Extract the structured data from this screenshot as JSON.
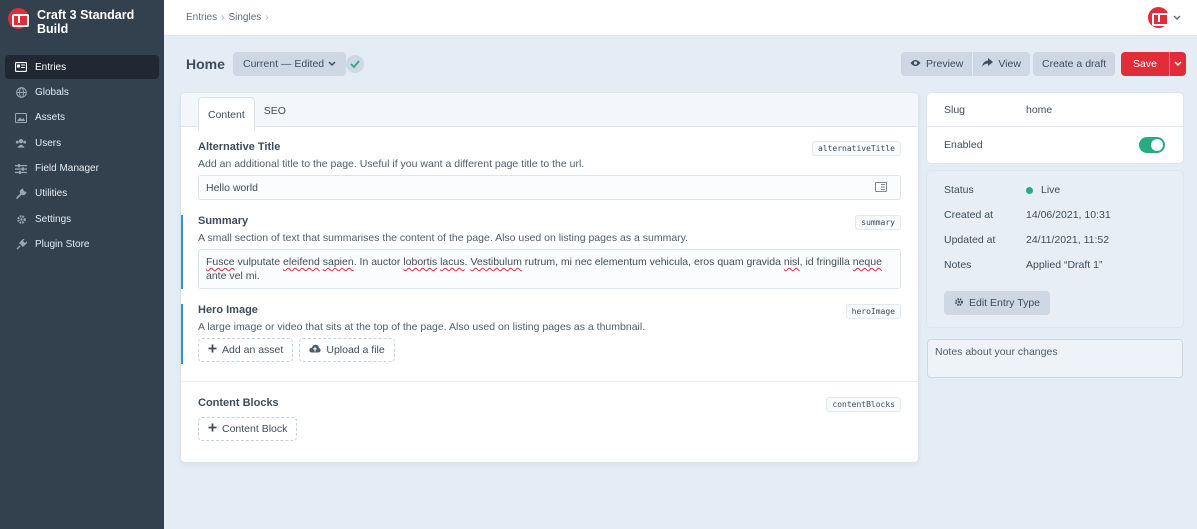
{
  "app": {
    "name": "Craft 3 Standard Build"
  },
  "sidebar": {
    "items": [
      {
        "label": "Entries",
        "icon": "entries-icon",
        "active": true
      },
      {
        "label": "Globals",
        "icon": "globe-icon",
        "active": false
      },
      {
        "label": "Assets",
        "icon": "image-icon",
        "active": false
      },
      {
        "label": "Users",
        "icon": "users-icon",
        "active": false
      },
      {
        "label": "Field Manager",
        "icon": "sliders-icon",
        "active": false
      },
      {
        "label": "Utilities",
        "icon": "wrench-icon",
        "active": false
      },
      {
        "label": "Settings",
        "icon": "gear-icon",
        "active": false
      },
      {
        "label": "Plugin Store",
        "icon": "plug-icon",
        "active": false
      }
    ]
  },
  "breadcrumb": {
    "items": [
      "Entries",
      "Singles"
    ]
  },
  "header": {
    "title": "Home",
    "revision_label": "Current — Edited",
    "preview_label": "Preview",
    "view_label": "View",
    "create_draft_label": "Create a draft",
    "save_label": "Save"
  },
  "tabs": [
    {
      "label": "Content",
      "active": true
    },
    {
      "label": "SEO",
      "active": false
    }
  ],
  "fields": {
    "alternative_title": {
      "label": "Alternative Title",
      "handle": "alternativeTitle",
      "instructions": "Add an additional title to the page. Useful if you want a different page title to the url.",
      "value": "Hello world"
    },
    "summary": {
      "label": "Summary",
      "handle": "summary",
      "instructions": "A small section of text that summarises the content of the page. Also used on listing pages as a summary.",
      "value_line1_a": "Fusce",
      "value_line1_b": " vulputate ",
      "value_line1_c": "eleifend",
      "value_line1_d": " ",
      "value_line1_e": "sapien",
      "value_line1_f": ". In auctor ",
      "value_line1_g": "lobortis",
      "value_line1_h": " ",
      "value_line1_i": "lacus",
      "value_line1_j": ". ",
      "value_line1_k": "Vestibulum",
      "value_line1_l": " rutrum, mi nec elementum vehicula, eros quam gravida ",
      "value_line1_m": "nisl",
      "value_line1_n": ", id fringilla ",
      "value_line1_o": "neque",
      "value_line2": "ante vel mi."
    },
    "hero_image": {
      "label": "Hero Image",
      "handle": "heroImage",
      "instructions": "A large image or video that sits at the top of the page. Also used on listing pages as a thumbnail.",
      "add_asset_label": "Add an asset",
      "upload_label": "Upload a file"
    },
    "content_blocks": {
      "label": "Content Blocks",
      "handle": "contentBlocks",
      "add_label": "Content Block"
    }
  },
  "meta": {
    "slug_label": "Slug",
    "slug_value": "home",
    "enabled_label": "Enabled",
    "enabled": true,
    "status_label": "Status",
    "status_value": "Live",
    "created_label": "Created at",
    "created_value": "14/06/2021, 10:31",
    "updated_label": "Updated at",
    "updated_value": "24/11/2021, 11:52",
    "notes_label": "Notes",
    "notes_value": "Applied “Draft 1”",
    "edit_type_label": "Edit Entry Type"
  },
  "notes_placeholder": "Notes about your changes",
  "colors": {
    "accent_red": "#e12d39",
    "sidebar_bg": "#33404d",
    "status_live": "#27ab83",
    "change_indicator": "#3990cc"
  }
}
